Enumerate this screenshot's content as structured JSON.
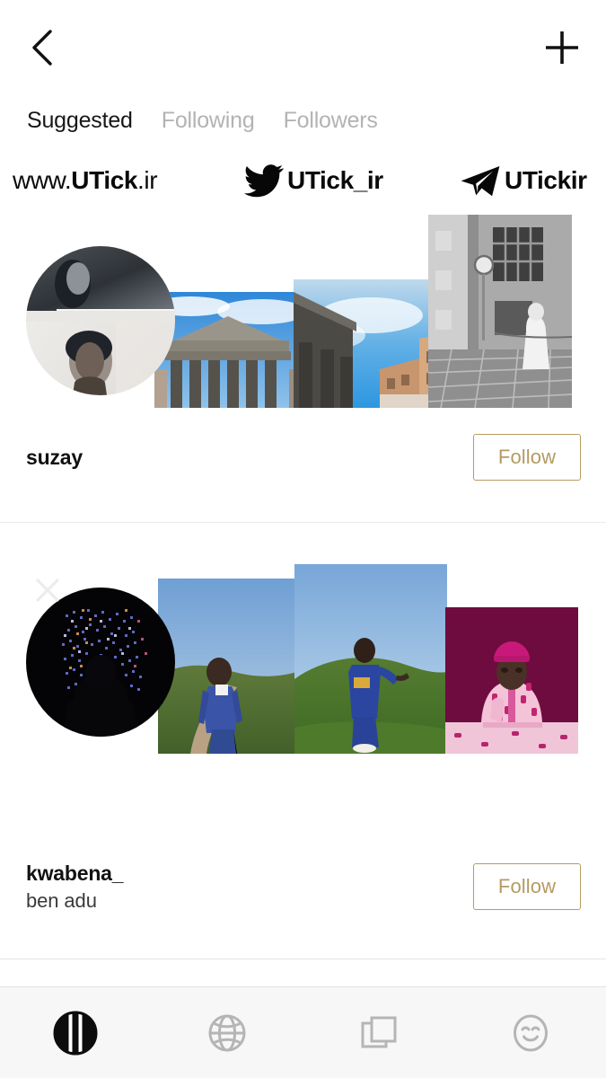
{
  "header": {
    "back_icon": "chevron-left-icon",
    "add_icon": "plus-icon"
  },
  "tabs": [
    {
      "label": "Suggested",
      "active": true
    },
    {
      "label": "Following",
      "active": false
    },
    {
      "label": "Followers",
      "active": false
    }
  ],
  "watermark": [
    {
      "icon": "none",
      "prefix": "www.",
      "bold": "UTick",
      "suffix": ".ir"
    },
    {
      "icon": "twitter-bird-icon",
      "prefix": "",
      "bold": "UTick_ir",
      "suffix": ""
    },
    {
      "icon": "telegram-plane-icon",
      "prefix": "",
      "bold": "UTickir",
      "suffix": ""
    }
  ],
  "suggestions": [
    {
      "username": "suzay",
      "fullname": "",
      "follow_label": "Follow",
      "dismiss_icon": "close-icon",
      "dismissable": false,
      "avatar_alt": "black-and-white portraits on a wall",
      "thumbs": [
        "pantheon-columns-blue-sky",
        "rome-buildings-clouds",
        "black-and-white-cobblestone-street-nun"
      ]
    },
    {
      "username": "kwabena_",
      "fullname": "ben adu",
      "follow_label": "Follow",
      "dismiss_icon": "close-icon",
      "dismissable": true,
      "avatar_alt": "silhouette in front of glowing light installation",
      "thumbs": [
        "man-blue-suit-on-path",
        "man-blue-suit-on-grass-hill",
        "man-pink-agbada-magenta-backdrop"
      ]
    }
  ],
  "bottom_nav": [
    {
      "icon": "striped-circle-icon",
      "active": true
    },
    {
      "icon": "globe-icon",
      "active": false
    },
    {
      "icon": "layers-squares-icon",
      "active": false
    },
    {
      "icon": "smiley-face-icon",
      "active": false
    }
  ],
  "colors": {
    "accent_gold": "#b89b5e",
    "tab_active": "#171717",
    "tab_inactive": "#b3b3b3",
    "nav_inactive": "#b5b5b5",
    "nav_active": "#0d0d0d",
    "background": "#ffffff",
    "navbar_background": "#f7f7f7"
  }
}
